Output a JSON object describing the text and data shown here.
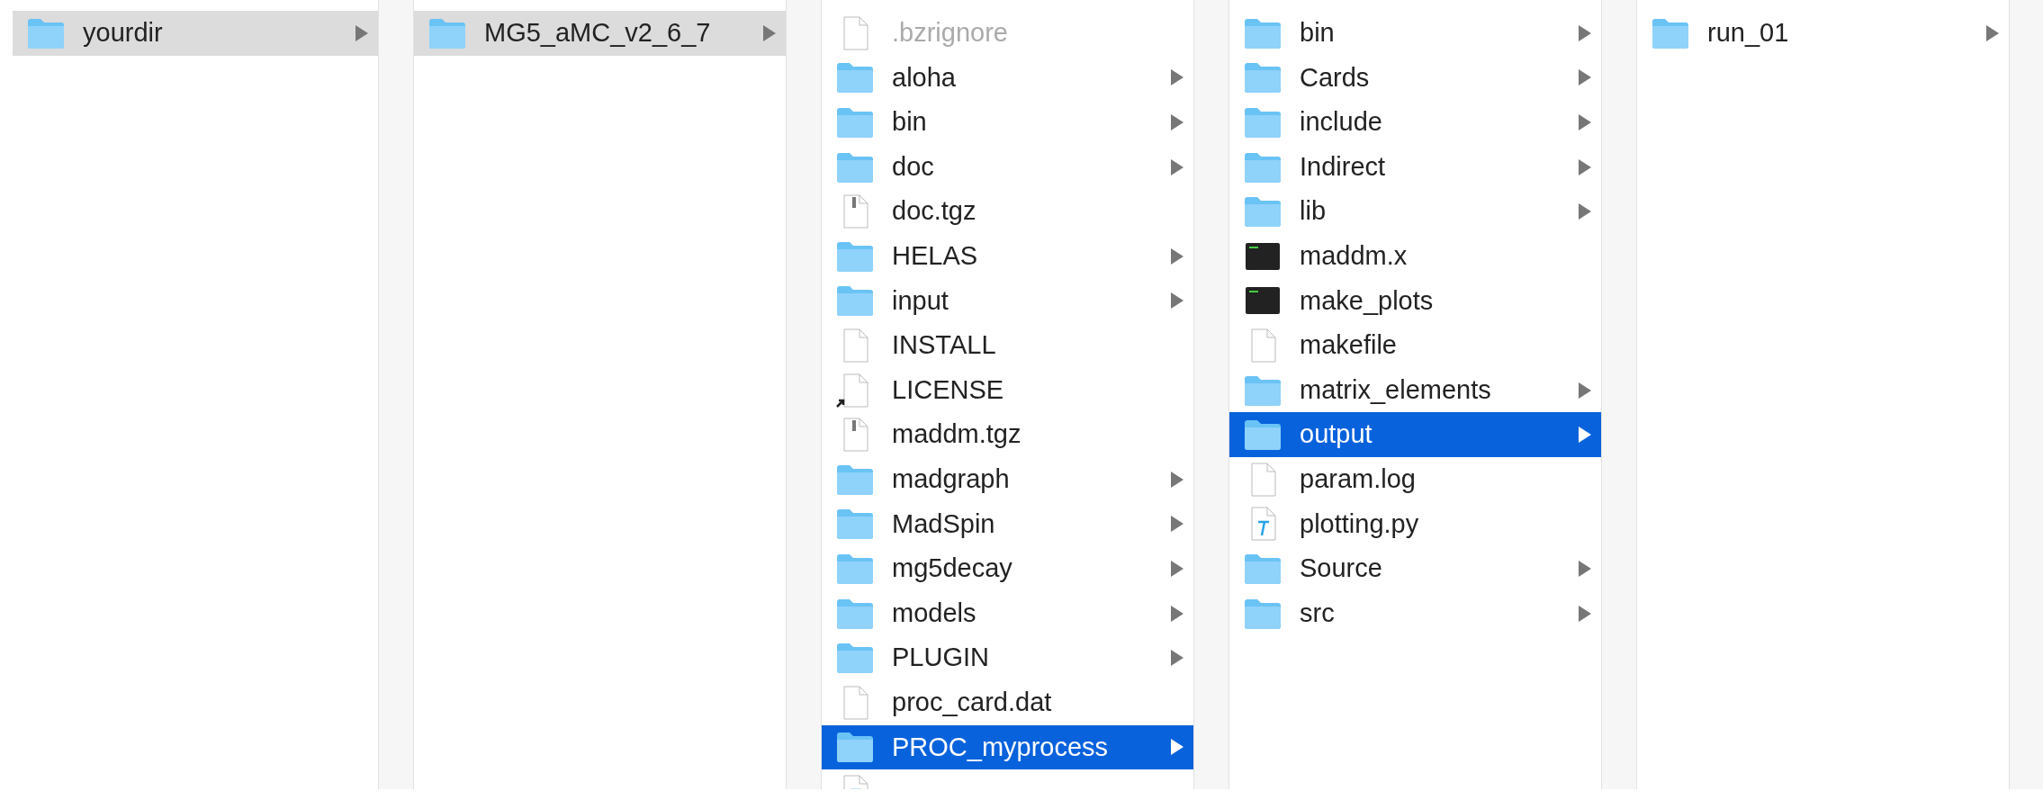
{
  "columns": [
    {
      "focused": false,
      "items": [
        {
          "name": "yourdir",
          "kind": "folder",
          "selected": true
        }
      ]
    },
    {
      "focused": false,
      "items": [
        {
          "name": "MG5_aMC_v2_6_7",
          "kind": "folder",
          "selected": true
        }
      ]
    },
    {
      "focused": true,
      "items": [
        {
          "name": ".bzrignore",
          "kind": "file",
          "selected": false,
          "dimmed": true
        },
        {
          "name": "aloha",
          "kind": "folder",
          "selected": false
        },
        {
          "name": "bin",
          "kind": "folder",
          "selected": false
        },
        {
          "name": "doc",
          "kind": "folder",
          "selected": false
        },
        {
          "name": "doc.tgz",
          "kind": "archive",
          "selected": false
        },
        {
          "name": "HELAS",
          "kind": "folder",
          "selected": false
        },
        {
          "name": "input",
          "kind": "folder",
          "selected": false
        },
        {
          "name": "INSTALL",
          "kind": "file",
          "selected": false
        },
        {
          "name": "LICENSE",
          "kind": "alias",
          "selected": false
        },
        {
          "name": "maddm.tgz",
          "kind": "archive",
          "selected": false
        },
        {
          "name": "madgraph",
          "kind": "folder",
          "selected": false
        },
        {
          "name": "MadSpin",
          "kind": "folder",
          "selected": false
        },
        {
          "name": "mg5decay",
          "kind": "folder",
          "selected": false
        },
        {
          "name": "models",
          "kind": "folder",
          "selected": false
        },
        {
          "name": "PLUGIN",
          "kind": "folder",
          "selected": false
        },
        {
          "name": "proc_card.dat",
          "kind": "file",
          "selected": false
        },
        {
          "name": "PROC_myprocess",
          "kind": "folder",
          "selected": true
        },
        {
          "kind": "script",
          "selected": false
        }
      ]
    },
    {
      "focused": true,
      "items": [
        {
          "name": "bin",
          "kind": "folder",
          "selected": false
        },
        {
          "name": "Cards",
          "kind": "folder",
          "selected": false
        },
        {
          "name": "include",
          "kind": "folder",
          "selected": false
        },
        {
          "name": "Indirect",
          "kind": "folder",
          "selected": false
        },
        {
          "name": "lib",
          "kind": "folder",
          "selected": false
        },
        {
          "name": "maddm.x",
          "kind": "executable",
          "selected": false
        },
        {
          "name": "make_plots",
          "kind": "executable",
          "selected": false
        },
        {
          "name": "makefile",
          "kind": "file",
          "selected": false
        },
        {
          "name": "matrix_elements",
          "kind": "folder",
          "selected": false
        },
        {
          "name": "output",
          "kind": "folder",
          "selected": true
        },
        {
          "name": "param.log",
          "kind": "file",
          "selected": false
        },
        {
          "name": "plotting.py",
          "kind": "script",
          "selected": false
        },
        {
          "name": "Source",
          "kind": "folder",
          "selected": false
        },
        {
          "name": "src",
          "kind": "folder",
          "selected": false
        }
      ]
    },
    {
      "items": [
        {
          "name": "run_01",
          "kind": "folder",
          "selected": false
        }
      ]
    }
  ]
}
